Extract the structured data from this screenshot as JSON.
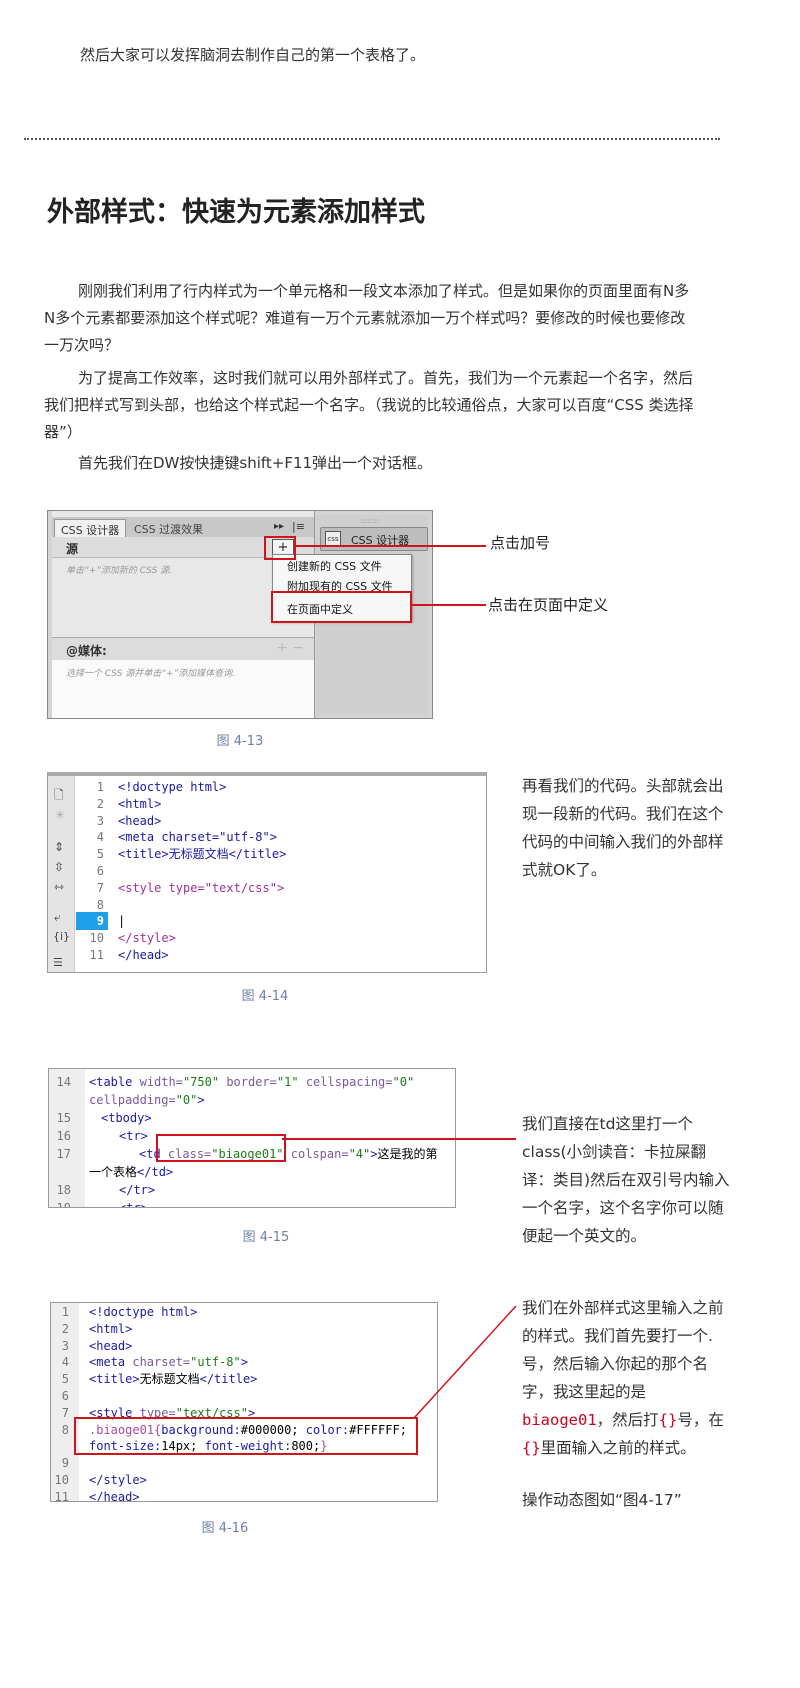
{
  "intro_line": "然后大家可以发挥脑洞去制作自己的第一个表格了。",
  "heading": "外部样式：快速为元素添加样式",
  "para1": "刚刚我们利用了行内样式为一个单元格和一段文本添加了样式。但是如果你的页面里面有N多N多个元素都要添加这个样式呢？难道有一万个元素就添加一万个样式吗？要修改的时候也要修改一万次吗？",
  "para2": "为了提高工作效率，这时我们就可以用外部样式了。首先，我们为一个元素起一个名字，然后我们把样式写到头部，也给这个样式起一个名字。（我说的比较通俗点，大家可以百度“CSS 类选择器”）",
  "para3": "首先我们在DW按快捷键shift+F11弹出一个对话框。",
  "fig13": {
    "caption": "图 4-13",
    "tab_active": "CSS 设计器",
    "tab_other": "CSS 过渡效果",
    "source_label": "源",
    "add_glyph": "+",
    "source_hint": "单击“+”添加新的 CSS 源.",
    "media_label": "@媒体:",
    "media_hint": "选择一个 CSS 源并单击“+”添加媒体查询.",
    "right_btn": "CSS 设计器",
    "menu": [
      "创建新的 CSS 文件",
      "附加现有的 CSS 文件",
      "在页面中定义"
    ],
    "callout_add": "点击加号",
    "callout_define": "点击在页面中定义"
  },
  "fig14": {
    "caption": "图 4-14",
    "lines": [
      {
        "n": "1",
        "code": "<!doctype html>"
      },
      {
        "n": "2",
        "code": "<html>"
      },
      {
        "n": "3",
        "code": "<head>"
      },
      {
        "n": "4",
        "code": "<meta charset=\"utf-8\">"
      },
      {
        "n": "5",
        "code": "<title>无标题文档</title>"
      },
      {
        "n": "6",
        "code": ""
      },
      {
        "n": "7",
        "code": "<style type=\"text/css\">"
      },
      {
        "n": "8",
        "code": ""
      },
      {
        "n": "9",
        "code": ""
      },
      {
        "n": "10",
        "code": "</style>"
      },
      {
        "n": "11",
        "code": "</head>"
      }
    ],
    "side_text": "再看我们的代码。头部就会出现一段新的代码。我们在这个代码的中间输入我们的外部样式就OK了。"
  },
  "fig15": {
    "caption": "图 4-15",
    "side_text": "我们直接在td这里打一个class(小剑读音：卡拉屎翻译：类目)然后在双引号内输入一个名字，这个名字你可以随便起一个英文的。"
  },
  "fig16": {
    "caption": "图 4-16",
    "side_text_1": "我们在外部样式这里输入之前的样式。我们首先要打一个.号，然后输入你起的那个名字，我这里起的是",
    "side_red_1": "biaoge01",
    "side_text_2": "，然后打",
    "side_red_2": "{}",
    "side_text_3": "号，在",
    "side_red_3": "{}",
    "side_text_4": "里面输入之前的样式。",
    "side_text_5": "操作动态图如“图4-17”"
  }
}
